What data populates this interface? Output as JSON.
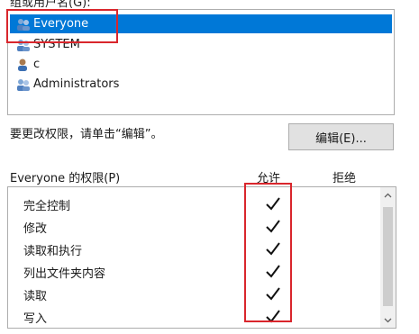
{
  "window": {
    "users_label": "组或用户名(G):",
    "users": [
      {
        "name": "Everyone",
        "icon": "users-group-icon",
        "selected": true
      },
      {
        "name": "SYSTEM",
        "icon": "users-group-icon",
        "selected": false
      },
      {
        "name": "c",
        "icon": "user-icon",
        "selected": false
      },
      {
        "name": "Administrators",
        "icon": "users-group-icon",
        "selected": false
      }
    ],
    "hint": "要更改权限，请单击“编辑”。",
    "edit_button_label": "编辑(E)...",
    "permissions_label": "Everyone 的权限(P)",
    "allow_header": "允许",
    "deny_header": "拒绝",
    "permissions": [
      {
        "name": "完全控制",
        "allow": true,
        "deny": false
      },
      {
        "name": "修改",
        "allow": true,
        "deny": false
      },
      {
        "name": "读取和执行",
        "allow": true,
        "deny": false
      },
      {
        "name": "列出文件夹内容",
        "allow": true,
        "deny": false
      },
      {
        "name": "读取",
        "allow": true,
        "deny": false
      },
      {
        "name": "写入",
        "allow": true,
        "deny": false
      }
    ],
    "colors": {
      "selection": "#0078d7",
      "highlight_box": "#d9262c",
      "button_bg": "#e1e1e1"
    }
  }
}
